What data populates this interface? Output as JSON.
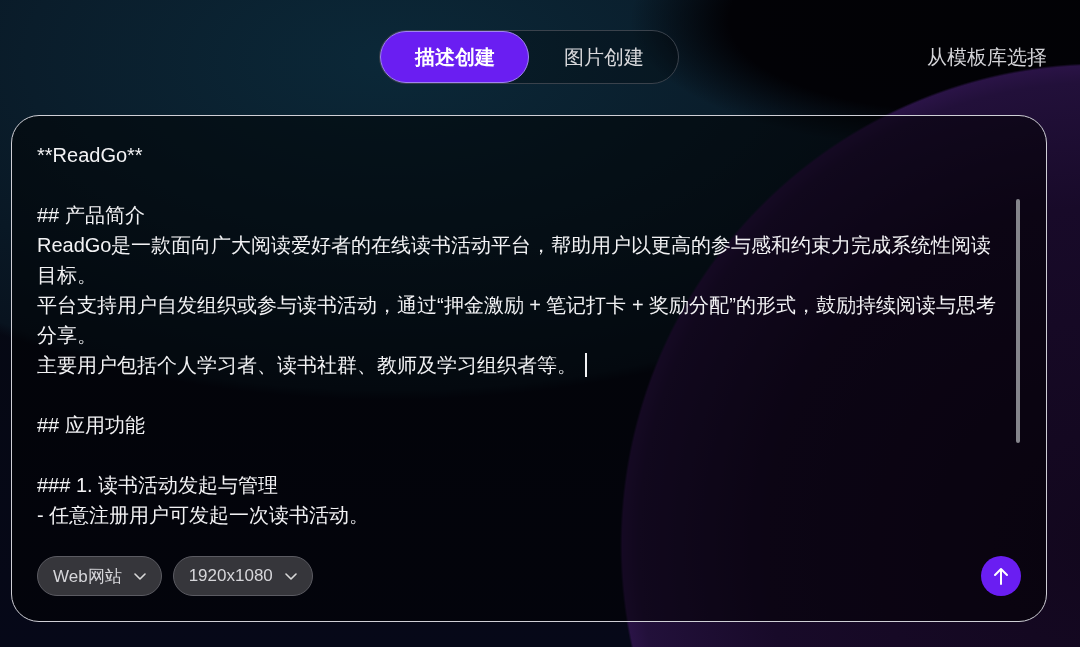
{
  "tabs": [
    {
      "label": "描述创建",
      "selected": true
    },
    {
      "label": "图片创建",
      "selected": false
    }
  ],
  "template_link": {
    "label": "从模板库选择"
  },
  "editor": {
    "sections": [
      {
        "lines": [
          {
            "text": "**ReadGo**",
            "caret": false
          }
        ]
      },
      {
        "lines": [
          {
            "text": "## 产品简介",
            "caret": false
          },
          {
            "text": "ReadGo是一款面向广大阅读爱好者的在线读书活动平台，帮助用户以更高的参与感和约束力完成系统性阅读目标。",
            "caret": false
          },
          {
            "text": "平台支持用户自发组织或参与读书活动，通过“押金激励 + 笔记打卡 + 奖励分配”的形式，鼓励持续阅读与思考分享。",
            "caret": false
          },
          {
            "text": "主要用户包括个人学习者、读书社群、教师及学习组织者等。",
            "caret": true
          }
        ]
      },
      {
        "lines": [
          {
            "text": "## 应用功能",
            "caret": false
          }
        ]
      },
      {
        "lines": [
          {
            "text": "### 1. 读书活动发起与管理",
            "caret": false
          },
          {
            "text": "- 任意注册用户可发起一次读书活动。",
            "caret": false
          }
        ]
      }
    ]
  },
  "dropdowns": [
    {
      "value": "Web网站"
    },
    {
      "value": "1920x1080"
    }
  ]
}
